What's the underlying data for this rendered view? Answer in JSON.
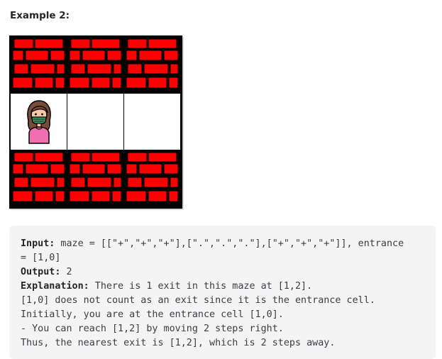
{
  "example": {
    "title": "Example 2:"
  },
  "maze": {
    "rows": [
      [
        "+",
        "+",
        "+"
      ],
      [
        ".",
        ".",
        "."
      ],
      [
        "+",
        "+",
        "+"
      ]
    ],
    "entrance": [
      1,
      0
    ],
    "wall_color": "#ff0000",
    "wall_outline": "#000000",
    "open_color": "#ffffff",
    "person_icon": "person-with-mask-icon"
  },
  "explanation_box": {
    "input_label": "Input:",
    "input_value_1": " maze = [[\"+\",\"+\",\"+\"],[\".\",\".\",\".\"],[\"+\",\"+\",\"+\"]], entrance",
    "input_value_2": "= [1,0]",
    "output_label": "Output:",
    "output_value": " 2",
    "explanation_label": "Explanation:",
    "explanation_value": " There is 1 exit in this maze at [1,2].",
    "line_4": "[1,0] does not count as an exit since it is the entrance cell.",
    "line_5": "Initially, you are at the entrance cell [1,0].",
    "line_6": "- You can reach [1,2] by moving 2 steps right.",
    "line_7": "Thus, the nearest exit is [1,2], which is 2 steps away."
  }
}
